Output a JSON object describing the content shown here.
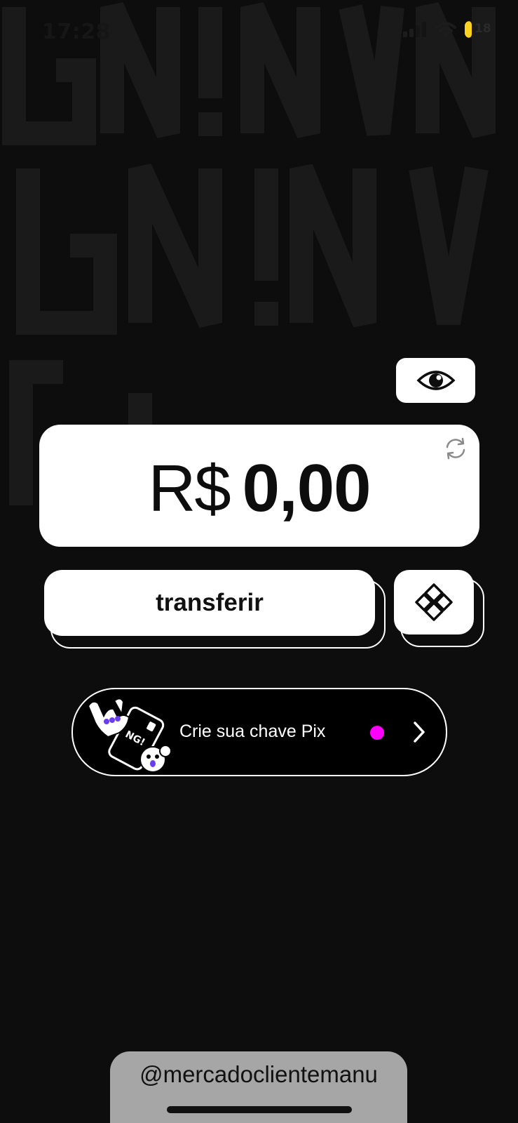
{
  "status_bar": {
    "time": "17:28",
    "battery_level": "18",
    "icons": [
      "signal-icon",
      "wifi-icon",
      "battery-icon"
    ],
    "battery_color": "#ffd21f"
  },
  "balance": {
    "currency": "R$",
    "amount": "0,00",
    "visibility_icon": "eye-icon",
    "refresh_icon": "refresh-icon"
  },
  "actions": {
    "transfer_label": "transferir",
    "pix_icon": "pix-icon"
  },
  "pix_banner": {
    "label": "Crie sua chave Pix",
    "indicator_color": "#ff00ff",
    "chevron_icon": "chevron-right-icon"
  },
  "overlay": {
    "watermark": "@mercadoclientemanu"
  },
  "colors": {
    "background": "#0d0d0d",
    "card": "#ffffff",
    "accent_purple": "#6b3df0"
  }
}
